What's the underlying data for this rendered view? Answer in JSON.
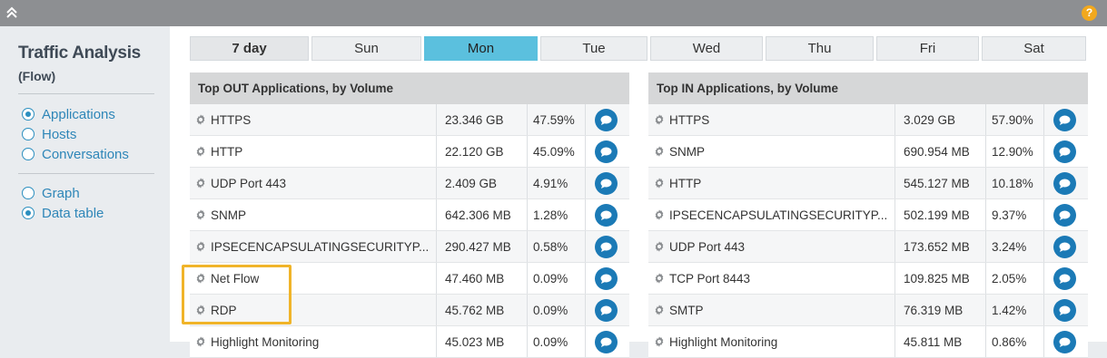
{
  "header": {
    "help_label": "?"
  },
  "sidebar": {
    "title": "Traffic Analysis",
    "subtitle": "(Flow)",
    "view_options": [
      {
        "label": "Applications",
        "selected": true
      },
      {
        "label": "Hosts",
        "selected": false
      },
      {
        "label": "Conversations",
        "selected": false
      }
    ],
    "display_options": [
      {
        "label": "Graph",
        "selected": false
      },
      {
        "label": "Data table",
        "selected": true
      }
    ]
  },
  "tabs": [
    {
      "label": "7 day",
      "bold": true,
      "active": false
    },
    {
      "label": "Sun",
      "bold": false,
      "active": false
    },
    {
      "label": "Mon",
      "bold": false,
      "active": true
    },
    {
      "label": "Tue",
      "bold": false,
      "active": false
    },
    {
      "label": "Wed",
      "bold": false,
      "active": false
    },
    {
      "label": "Thu",
      "bold": false,
      "active": false
    },
    {
      "label": "Fri",
      "bold": false,
      "active": false
    },
    {
      "label": "Sat",
      "bold": false,
      "active": false
    }
  ],
  "out_table": {
    "title": "Top OUT Applications, by Volume",
    "rows": [
      {
        "name": "HTTPS",
        "volume": "23.346 GB",
        "percent": "47.59%"
      },
      {
        "name": "HTTP",
        "volume": "22.120 GB",
        "percent": "45.09%"
      },
      {
        "name": "UDP Port 443",
        "volume": "2.409 GB",
        "percent": "4.91%"
      },
      {
        "name": "SNMP",
        "volume": "642.306 MB",
        "percent": "1.28%"
      },
      {
        "name": "IPSECENCAPSULATINGSECURITYP...",
        "volume": "290.427 MB",
        "percent": "0.58%"
      },
      {
        "name": "Net Flow",
        "volume": "47.460 MB",
        "percent": "0.09%"
      },
      {
        "name": "RDP",
        "volume": "45.762 MB",
        "percent": "0.09%"
      },
      {
        "name": "Highlight Monitoring",
        "volume": "45.023 MB",
        "percent": "0.09%"
      }
    ]
  },
  "in_table": {
    "title": "Top IN Applications, by Volume",
    "rows": [
      {
        "name": "HTTPS",
        "volume": "3.029 GB",
        "percent": "57.90%"
      },
      {
        "name": "SNMP",
        "volume": "690.954 MB",
        "percent": "12.90%"
      },
      {
        "name": "HTTP",
        "volume": "545.127 MB",
        "percent": "10.18%"
      },
      {
        "name": "IPSECENCAPSULATINGSECURITYP...",
        "volume": "502.199 MB",
        "percent": "9.37%"
      },
      {
        "name": "UDP Port 443",
        "volume": "173.652 MB",
        "percent": "3.24%"
      },
      {
        "name": "TCP Port 8443",
        "volume": "109.825 MB",
        "percent": "2.05%"
      },
      {
        "name": "SMTP",
        "volume": "76.319 MB",
        "percent": "1.42%"
      },
      {
        "name": "Highlight Monitoring",
        "volume": "45.811 MB",
        "percent": "0.86%"
      }
    ]
  },
  "colors": {
    "accent": "#5bc0de",
    "link": "#2e86b8",
    "action": "#1b7ab6",
    "highlight": "#f0b429"
  }
}
